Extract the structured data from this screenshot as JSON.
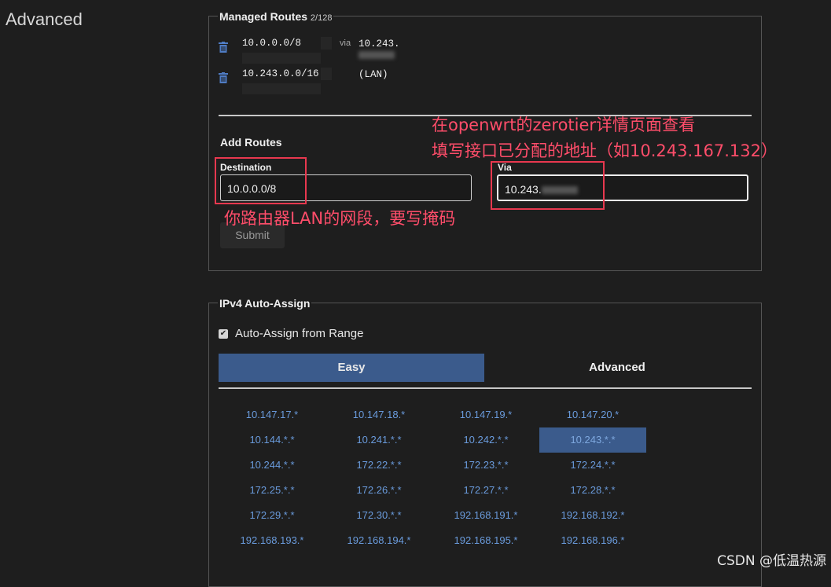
{
  "side_title": "Advanced",
  "managed_routes": {
    "title": "Managed Routes",
    "count": "2/128",
    "routes": [
      {
        "destination": "10.0.0.0/8",
        "via_label": "via",
        "via": "10.243."
      },
      {
        "destination": "10.243.0.0/16",
        "via_label": "",
        "via": "(LAN)"
      }
    ],
    "add_title": "Add Routes",
    "destination_label": "Destination",
    "destination_value": "10.0.0.0/8",
    "via_label": "Via",
    "via_value": "10.243.",
    "submit_label": "Submit"
  },
  "annotations": {
    "via_hint_line1": "在openwrt的zerotier详情页面查看",
    "via_hint_line2": "填写接口已分配的地址（如10.243.167.132）",
    "dest_hint": "你路由器LAN的网段，要写掩码",
    "color": "#e8384f"
  },
  "ipv4": {
    "title": "IPv4 Auto-Assign",
    "auto_assign_label": "Auto-Assign from Range",
    "auto_assign_checked": true,
    "tabs": {
      "easy": "Easy",
      "advanced": "Advanced"
    },
    "selected_range": "10.243.*.*",
    "ranges": [
      [
        "10.147.17.*",
        "10.147.18.*",
        "10.147.19.*",
        "10.147.20.*"
      ],
      [
        "10.144.*.*",
        "10.241.*.*",
        "10.242.*.*",
        "10.243.*.*"
      ],
      [
        "10.244.*.*",
        "172.22.*.*",
        "172.23.*.*",
        "172.24.*.*"
      ],
      [
        "172.25.*.*",
        "172.26.*.*",
        "172.27.*.*",
        "172.28.*.*"
      ],
      [
        "172.29.*.*",
        "172.30.*.*",
        "192.168.191.*",
        "192.168.192.*"
      ],
      [
        "192.168.193.*",
        "192.168.194.*",
        "192.168.195.*",
        "192.168.196.*"
      ]
    ]
  },
  "watermark": "CSDN @低温热源",
  "colors": {
    "accent": "#3b5b8c",
    "link": "#6a9bdc",
    "background": "#1e1e1e"
  }
}
